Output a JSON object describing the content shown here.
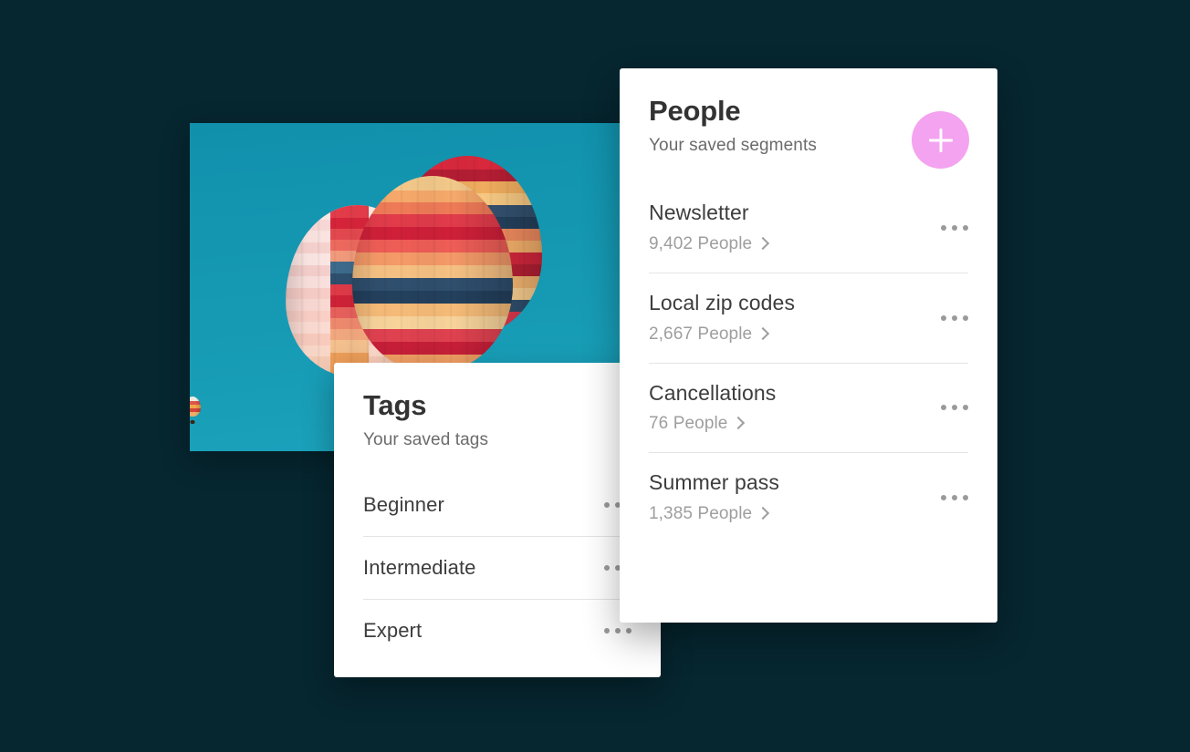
{
  "background_color": "#062630",
  "photo": {
    "alt": "two hot air balloons in a teal sky",
    "sky_color": "#1596b0"
  },
  "tags_card": {
    "title": "Tags",
    "subtitle": "Your saved tags",
    "menu_icon": "kebab-menu-icon",
    "items": [
      {
        "name": "Beginner"
      },
      {
        "name": "Intermediate"
      },
      {
        "name": "Expert"
      }
    ]
  },
  "people_card": {
    "title": "People",
    "subtitle": "Your saved segments",
    "add_button": {
      "icon": "plus-icon",
      "color": "#f3a3ef"
    },
    "menu_icon": "kebab-menu-icon",
    "chevron_icon": "chevron-right-icon",
    "items": [
      {
        "name": "Newsletter",
        "count": "9,402 People"
      },
      {
        "name": "Local zip codes",
        "count": "2,667 People"
      },
      {
        "name": "Cancellations",
        "count": "76 People"
      },
      {
        "name": "Summer pass",
        "count": "1,385 People"
      }
    ]
  }
}
